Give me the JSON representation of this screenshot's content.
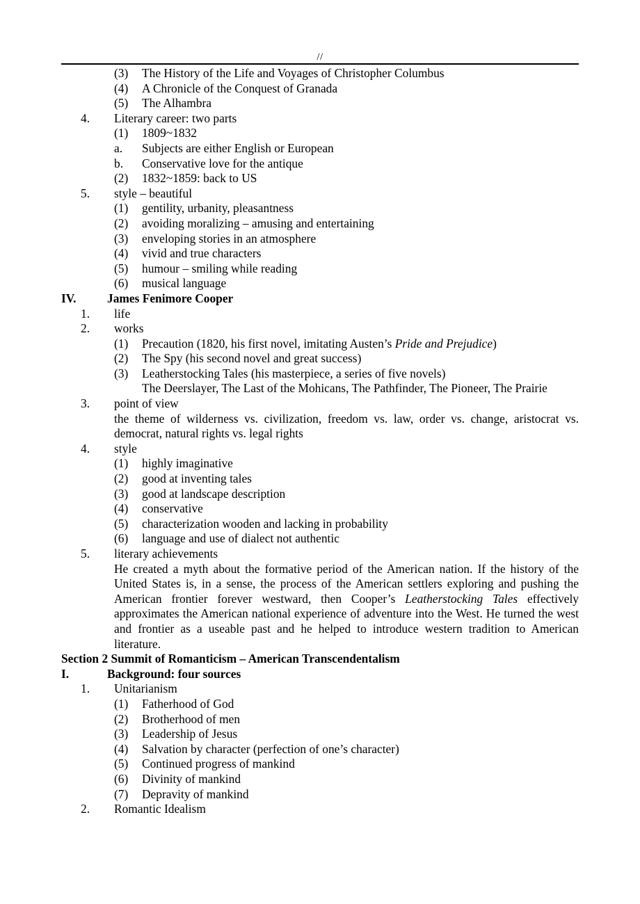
{
  "header": {
    "mark": "//"
  },
  "outline": {
    "irving_works": [
      {
        "marker": "(3)",
        "text": "The History of the Life and Voyages of Christopher Columbus"
      },
      {
        "marker": "(4)",
        "text": "A Chronicle of the Conquest of Granada"
      },
      {
        "marker": "(5)",
        "text": "The Alhambra"
      }
    ],
    "irving_item4": {
      "marker": "4.",
      "text": "Literary career: two parts"
    },
    "irving_item4_sub": [
      {
        "marker": "(1)",
        "text": "1809~1832"
      },
      {
        "marker": "a.",
        "text": "Subjects are either English or European"
      },
      {
        "marker": "b.",
        "text": "Conservative love for the antique"
      },
      {
        "marker": "(2)",
        "text": "1832~1859: back to US"
      }
    ],
    "irving_item5": {
      "marker": "5.",
      "text": "style – beautiful"
    },
    "irving_item5_sub": [
      {
        "marker": "(1)",
        "text": "gentility, urbanity, pleasantness"
      },
      {
        "marker": "(2)",
        "text": "avoiding moralizing – amusing and entertaining"
      },
      {
        "marker": "(3)",
        "text": "enveloping stories in an atmosphere"
      },
      {
        "marker": "(4)",
        "text": "vivid and true characters"
      },
      {
        "marker": "(5)",
        "text": "humour – smiling while reading"
      },
      {
        "marker": "(6)",
        "text": "musical language"
      }
    ],
    "cooper_heading": {
      "marker": "IV.",
      "text": "James Fenimore Cooper"
    },
    "cooper_item1": {
      "marker": "1.",
      "text": "life"
    },
    "cooper_item2": {
      "marker": "2.",
      "text": "works"
    },
    "cooper_works": {
      "w1_marker": "(1)",
      "w1_pre": "Precaution (1820, his first novel, imitating Austen’s ",
      "w1_italic": "Pride and Prejudice",
      "w1_post": ")",
      "w2_marker": "(2)",
      "w2_text": "The Spy (his second novel and great success)",
      "w3_marker": "(3)",
      "w3_text": "Leatherstocking Tales (his masterpiece, a series of five novels)",
      "w3_continuation": "The Deerslayer, The Last of the Mohicans, The Pathfinder, The Pioneer, The Prairie"
    },
    "cooper_item3": {
      "marker": "3.",
      "text": "point of view"
    },
    "cooper_item3_para": "the theme of wilderness vs. civilization, freedom vs. law, order vs. change, aristocrat vs. democrat, natural rights vs. legal rights",
    "cooper_item4": {
      "marker": "4.",
      "text": "style"
    },
    "cooper_item4_sub": [
      {
        "marker": "(1)",
        "text": "highly imaginative"
      },
      {
        "marker": "(2)",
        "text": "good at inventing tales"
      },
      {
        "marker": "(3)",
        "text": "good at landscape description"
      },
      {
        "marker": "(4)",
        "text": "conservative"
      },
      {
        "marker": "(5)",
        "text": "characterization wooden and lacking in probability"
      },
      {
        "marker": "(6)",
        "text": "language and use of dialect not authentic"
      }
    ],
    "cooper_item5": {
      "marker": "5.",
      "text": "literary achievements"
    },
    "cooper_item5_para": {
      "part1": "He created a myth about the formative period of the American nation. If the history of the United States is, in a sense, the process of the American settlers exploring and pushing the American frontier forever westward, then Cooper’s ",
      "italic": "Leatherstocking Tales",
      "part2": " effectively approximates the American national experience of adventure into the West. He turned the west and frontier as a useable past and he helped to introduce western tradition to American literature."
    },
    "section2_heading": "Section 2 Summit of Romanticism – American Transcendentalism",
    "section2_roman": {
      "marker": "I.",
      "text": "Background: four sources"
    },
    "unitarianism": {
      "marker": "1.",
      "text": "Unitarianism"
    },
    "unitarianism_sub": [
      {
        "marker": "(1)",
        "text": "Fatherhood of God"
      },
      {
        "marker": "(2)",
        "text": "Brotherhood of men"
      },
      {
        "marker": "(3)",
        "text": "Leadership of Jesus"
      },
      {
        "marker": "(4)",
        "text": "Salvation by character (perfection of one’s character)"
      },
      {
        "marker": "(5)",
        "text": "Continued progress of mankind"
      },
      {
        "marker": "(6)",
        "text": "Divinity of mankind"
      },
      {
        "marker": "(7)",
        "text": "Depravity of mankind"
      }
    ],
    "romantic_idealism": {
      "marker": "2.",
      "text": "Romantic Idealism"
    }
  }
}
